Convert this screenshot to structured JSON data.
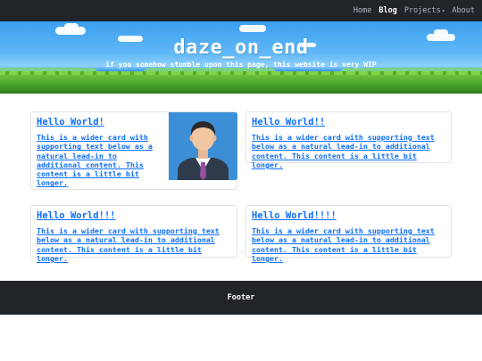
{
  "nav": {
    "items": [
      {
        "label": "Home",
        "active": false
      },
      {
        "label": "Blog",
        "active": true
      },
      {
        "label": "Projects",
        "active": false
      },
      {
        "label": "About",
        "active": false
      }
    ]
  },
  "hero": {
    "title": "daze_on_end",
    "subtitle": "if you somehow stumble upon this page, this website is very WIP"
  },
  "cards": [
    {
      "title": "Hello World!",
      "text": "This is a wider card with supporting text below as a natural lead-in to additional content. This content is a little bit longer.",
      "image": "person-avatar-icon"
    },
    {
      "title": "Hello World!!",
      "text": "This is a wider card with supporting text below as a natural lead-in to additional content. This content is a little bit longer."
    },
    {
      "title": "Hello World!!!",
      "text": "This is a wider card with supporting text below as a natural lead-in to additional content. This content is a little bit longer."
    },
    {
      "title": "Hello World!!!!",
      "text": "This is a wider card with supporting text below as a natural lead-in to additional content. This content is a little bit longer."
    }
  ],
  "footer": {
    "text": "Footer"
  },
  "colors": {
    "navbar": "#212529",
    "link": "#0d6efd",
    "sky": "#3a9ff0",
    "grass": "#4aa52a",
    "footer": "#212529"
  }
}
